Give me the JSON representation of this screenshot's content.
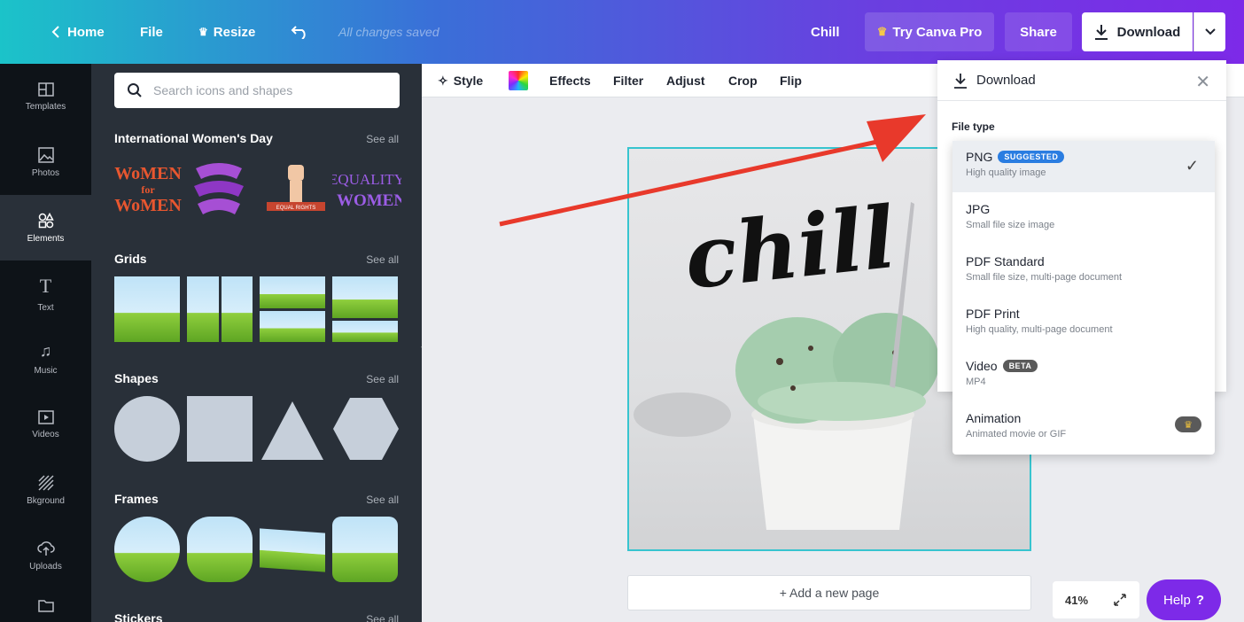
{
  "topbar": {
    "home": "Home",
    "file": "File",
    "resize": "Resize",
    "saved_status": "All changes saved",
    "design_name": "Chill",
    "try_pro": "Try Canva Pro",
    "share": "Share",
    "download": "Download"
  },
  "rail": {
    "items": [
      {
        "label": "Templates",
        "icon": "templates-icon"
      },
      {
        "label": "Photos",
        "icon": "photos-icon"
      },
      {
        "label": "Elements",
        "icon": "elements-icon"
      },
      {
        "label": "Text",
        "icon": "text-icon"
      },
      {
        "label": "Music",
        "icon": "music-icon"
      },
      {
        "label": "Videos",
        "icon": "videos-icon"
      },
      {
        "label": "Bkground",
        "icon": "background-icon"
      },
      {
        "label": "Uploads",
        "icon": "uploads-icon"
      },
      {
        "label": "",
        "icon": "folder-icon"
      }
    ]
  },
  "panel": {
    "search_placeholder": "Search icons and shapes",
    "sections": [
      {
        "title": "International Women's Day",
        "see_all": "See all"
      },
      {
        "title": "Grids",
        "see_all": "See all"
      },
      {
        "title": "Shapes",
        "see_all": "See all"
      },
      {
        "title": "Frames",
        "see_all": "See all"
      },
      {
        "title": "Stickers",
        "see_all": "See all"
      }
    ],
    "stickers": [
      "WOMEN FOR WOMEN",
      "EQUALITY WOMEN"
    ]
  },
  "toolbar": {
    "style": "Style",
    "effects": "Effects",
    "filter": "Filter",
    "adjust": "Adjust",
    "crop": "Crop",
    "flip": "Flip"
  },
  "canvas": {
    "heading_text": "chill",
    "add_page": "+ Add a new page",
    "zoom": "41%",
    "help": "Help"
  },
  "download_panel": {
    "title": "Download",
    "file_type_label": "File type",
    "options": [
      {
        "name": "PNG",
        "badge": "SUGGESTED",
        "desc": "High quality image",
        "selected": true
      },
      {
        "name": "JPG",
        "badge": "",
        "desc": "Small file size image",
        "selected": false
      },
      {
        "name": "PDF Standard",
        "badge": "",
        "desc": "Small file size, multi-page document",
        "selected": false
      },
      {
        "name": "PDF Print",
        "badge": "",
        "desc": "High quality, multi-page document",
        "selected": false
      },
      {
        "name": "Video",
        "badge": "BETA",
        "desc": "MP4",
        "selected": false
      },
      {
        "name": "Animation",
        "badge": "",
        "desc": "Animated movie or GIF",
        "selected": false,
        "pro": true
      }
    ]
  },
  "colors": {
    "accent": "#7d2ae8",
    "selection": "#37c4cf",
    "suggested_badge": "#2a7de1",
    "beta_badge": "#5a5a5a",
    "arrow": "#e8392b"
  }
}
